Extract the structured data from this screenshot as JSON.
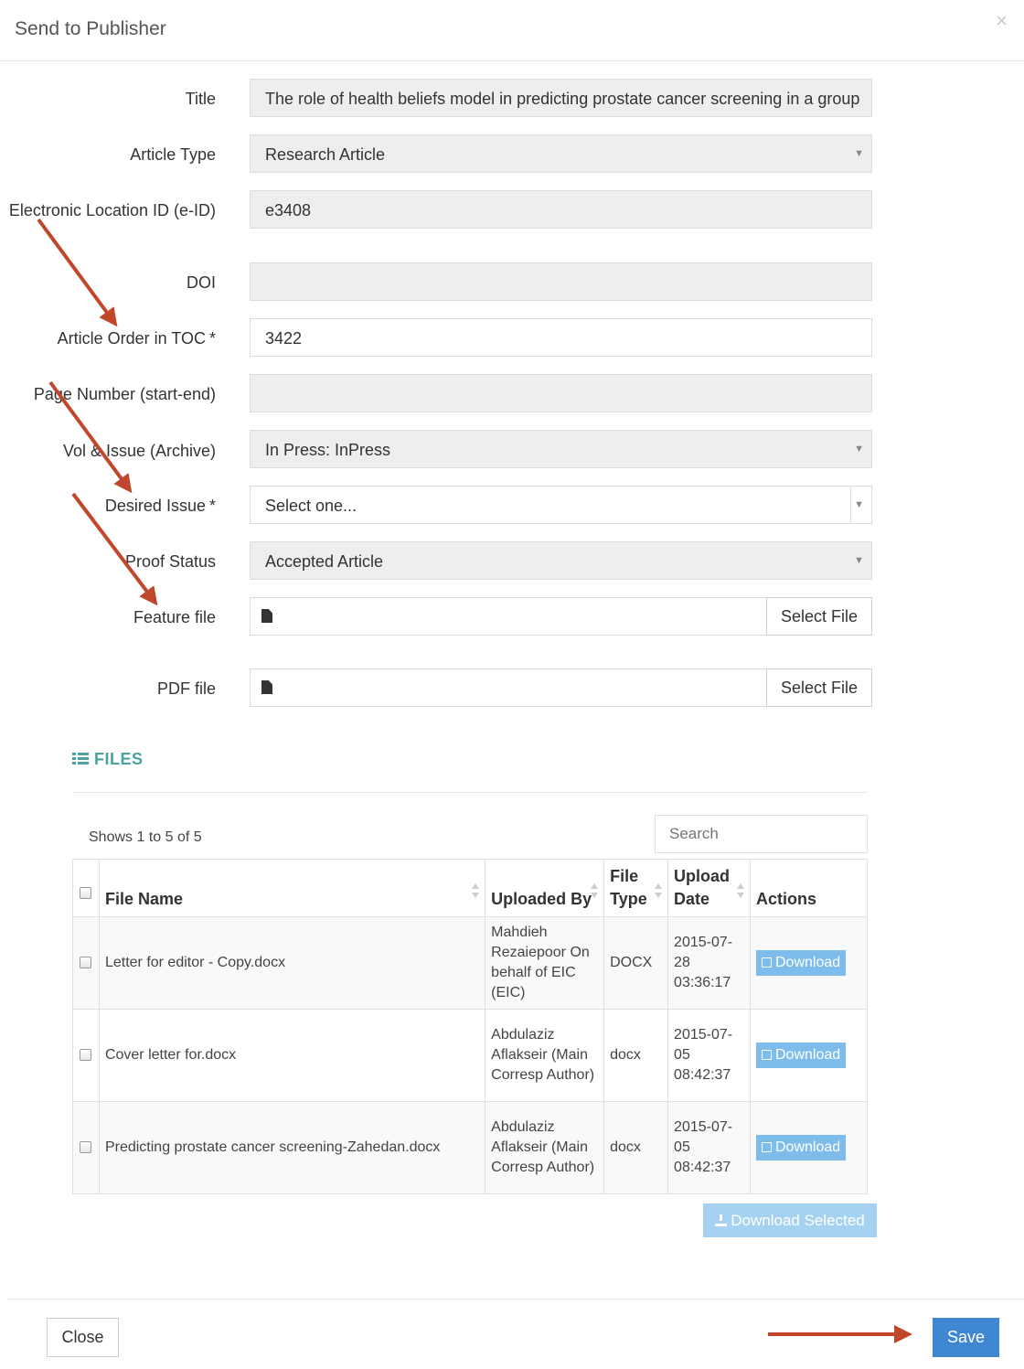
{
  "modal": {
    "title": "Send to Publisher",
    "close_symbol": "×"
  },
  "form": {
    "title": {
      "label": "Title",
      "value": "The role of health beliefs model in predicting prostate cancer screening in a group"
    },
    "article_type": {
      "label": "Article Type",
      "value": "Research Article"
    },
    "eid": {
      "label": "Electronic Location ID (e-ID)",
      "value": "e3408"
    },
    "doi": {
      "label": "DOI",
      "value": ""
    },
    "toc_order": {
      "label": "Article Order in TOC",
      "required_mark": "*",
      "value": "3422"
    },
    "page_number": {
      "label": "Page Number (start-end)",
      "value": ""
    },
    "vol_issue": {
      "label": "Vol & Issue (Archive)",
      "value": "In Press: InPress"
    },
    "desired_issue": {
      "label": "Desired Issue",
      "required_mark": "*",
      "value": "Select one..."
    },
    "proof_status": {
      "label": "Proof Status",
      "value": "Accepted Article"
    },
    "feature_file": {
      "label": "Feature file",
      "button": "Select File"
    },
    "pdf_file": {
      "label": "PDF file",
      "button": "Select File"
    }
  },
  "files": {
    "heading": "FILES",
    "shows_text": "Shows 1 to 5 of 5",
    "search_placeholder": "Search",
    "columns": [
      "File Name",
      "Uploaded By",
      "File Type",
      "Upload Date",
      "Actions"
    ],
    "rows": [
      {
        "name": "Letter for editor - Copy.docx",
        "uploaded_by": "Mahdieh Rezaiepoor On behalf of EIC (EIC)",
        "type": "DOCX",
        "date": "2015-07-28 03:36:17",
        "action": "Download"
      },
      {
        "name": "Cover letter for.docx",
        "uploaded_by": "Abdulaziz Aflakseir (Main Corresp Author)",
        "type": "docx",
        "date": "2015-07-05 08:42:37",
        "action": "Download"
      },
      {
        "name": "Predicting prostate cancer screening-Zahedan.docx",
        "uploaded_by": "Abdulaziz Aflakseir (Main Corresp Author)",
        "type": "docx",
        "date": "2015-07-05 08:42:37",
        "action": "Download"
      }
    ],
    "download_selected": "Download Selected"
  },
  "footer": {
    "close_label": "Close",
    "save_label": "Save"
  },
  "colors": {
    "arrow": "#c0462c",
    "primary": "#3f87d1",
    "accent_teal": "#4aa3a0"
  },
  "icons": [
    "close-icon",
    "file-icon",
    "list-icon",
    "sort-icon",
    "edit-icon",
    "download-icon",
    "caret-down-icon",
    "arrow-annotation"
  ]
}
